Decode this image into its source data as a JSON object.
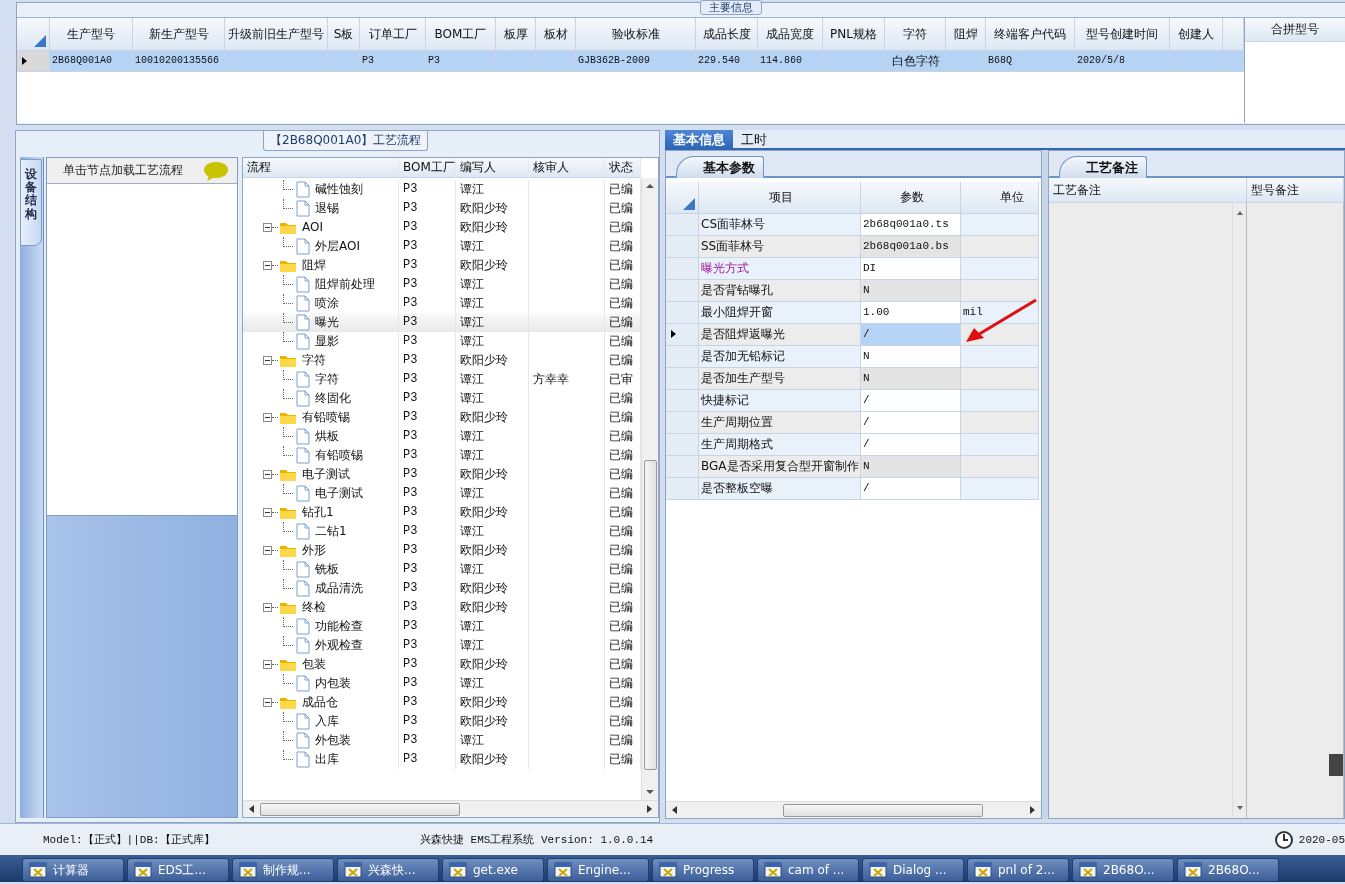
{
  "main_info": {
    "title": "主要信息",
    "columns": [
      "生产型号",
      "新生产型号",
      "升级前旧生产型号",
      "S板",
      "订单工厂",
      "BOM工厂",
      "板厚",
      "板材",
      "验收标准",
      "成品长度",
      "成品宽度",
      "PNL规格",
      "字符",
      "阻焊",
      "终端客户代码",
      "型号创建时间",
      "创建人"
    ],
    "rows": [
      {
        "selected": true,
        "cells": [
          "2B68Q001A0",
          "10010200135566",
          null,
          null,
          "P3",
          "P3",
          null,
          null,
          "GJB362B-2009",
          "229.540",
          "114.860",
          null,
          "白色字符",
          null,
          "B68Q",
          "2020/5/8",
          null
        ]
      }
    ],
    "side_column": "合拼型号"
  },
  "process": {
    "title": "【2B68Q001A0】工艺流程",
    "side_tab": "设备结构",
    "hint": "单击节点加载工艺流程",
    "columns": [
      "流程",
      "BOM工厂",
      "编写人",
      "核审人",
      "状态"
    ],
    "rows": [
      {
        "kind": "file",
        "name": "碱性蚀刻",
        "bom": "P3",
        "writer": "谭江",
        "status": "已编",
        "selected": false
      },
      {
        "kind": "file",
        "name": "退锡",
        "bom": "P3",
        "writer": "欧阳少玲",
        "status": "已编",
        "selected": false
      },
      {
        "kind": "folder",
        "name": "AOI",
        "bom": "P3",
        "writer": "欧阳少玲",
        "status": "已编",
        "selected": false,
        "expanded": true,
        "children": [
          {
            "kind": "file",
            "name": "外层AOI",
            "bom": "P3",
            "writer": "谭江",
            "status": "已编",
            "selected": false
          }
        ]
      },
      {
        "kind": "folder",
        "name": "阻焊",
        "bom": "P3",
        "writer": "欧阳少玲",
        "status": "已编",
        "selected": false,
        "expanded": true,
        "children": [
          {
            "kind": "file",
            "name": "阻焊前处理",
            "bom": "P3",
            "writer": "谭江",
            "status": "已编",
            "selected": false
          },
          {
            "kind": "file",
            "name": "喷涂",
            "bom": "P3",
            "writer": "谭江",
            "status": "已编",
            "selected": false
          },
          {
            "kind": "file",
            "name": "曝光",
            "bom": "P3",
            "writer": "谭江",
            "status": "已编",
            "selected": true
          },
          {
            "kind": "file",
            "name": "显影",
            "bom": "P3",
            "writer": "谭江",
            "status": "已编",
            "selected": false
          }
        ]
      },
      {
        "kind": "folder",
        "name": "字符",
        "bom": "P3",
        "writer": "欧阳少玲",
        "status": "已编",
        "selected": false,
        "expanded": true,
        "children": [
          {
            "kind": "file",
            "name": "字符",
            "bom": "P3",
            "writer": "谭江",
            "reviewer": "方幸幸",
            "status": "已审",
            "selected": false
          },
          {
            "kind": "file",
            "name": "终固化",
            "bom": "P3",
            "writer": "谭江",
            "status": "已编",
            "selected": false
          }
        ]
      },
      {
        "kind": "folder",
        "name": "有铅喷锡",
        "bom": "P3",
        "writer": "欧阳少玲",
        "status": "已编",
        "selected": false,
        "expanded": true,
        "children": [
          {
            "kind": "file",
            "name": "烘板",
            "bom": "P3",
            "writer": "谭江",
            "status": "已编",
            "selected": false
          },
          {
            "kind": "file",
            "name": "有铅喷锡",
            "bom": "P3",
            "writer": "谭江",
            "status": "已编",
            "selected": false
          }
        ]
      },
      {
        "kind": "folder",
        "name": "电子测试",
        "bom": "P3",
        "writer": "欧阳少玲",
        "status": "已编",
        "selected": false,
        "expanded": true,
        "children": [
          {
            "kind": "file",
            "name": "电子测试",
            "bom": "P3",
            "writer": "谭江",
            "status": "已编",
            "selected": false
          }
        ]
      },
      {
        "kind": "folder",
        "name": "钻孔1",
        "bom": "P3",
        "writer": "欧阳少玲",
        "status": "已编",
        "selected": false,
        "expanded": true,
        "children": [
          {
            "kind": "file",
            "name": "二钻1",
            "bom": "P3",
            "writer": "谭江",
            "status": "已编",
            "selected": false
          }
        ]
      },
      {
        "kind": "folder",
        "name": "外形",
        "bom": "P3",
        "writer": "欧阳少玲",
        "status": "已编",
        "selected": false,
        "expanded": true,
        "children": [
          {
            "kind": "file",
            "name": "铣板",
            "bom": "P3",
            "writer": "谭江",
            "status": "已编",
            "selected": false
          },
          {
            "kind": "file",
            "name": "成品清洗",
            "bom": "P3",
            "writer": "欧阳少玲",
            "status": "已编",
            "selected": false
          }
        ]
      },
      {
        "kind": "folder",
        "name": "终检",
        "bom": "P3",
        "writer": "欧阳少玲",
        "status": "已编",
        "selected": false,
        "expanded": true,
        "children": [
          {
            "kind": "file",
            "name": "功能检查",
            "bom": "P3",
            "writer": "谭江",
            "status": "已编",
            "selected": false
          },
          {
            "kind": "file",
            "name": "外观检查",
            "bom": "P3",
            "writer": "谭江",
            "status": "已编",
            "selected": false
          }
        ]
      },
      {
        "kind": "folder",
        "name": "包装",
        "bom": "P3",
        "writer": "欧阳少玲",
        "status": "已编",
        "selected": false,
        "expanded": true,
        "children": [
          {
            "kind": "file",
            "name": "内包装",
            "bom": "P3",
            "writer": "谭江",
            "status": "已编",
            "selected": false
          }
        ]
      },
      {
        "kind": "folder",
        "name": "成品仓",
        "bom": "P3",
        "writer": "欧阳少玲",
        "status": "已编",
        "selected": false,
        "expanded": true,
        "children": [
          {
            "kind": "file",
            "name": "入库",
            "bom": "P3",
            "writer": "欧阳少玲",
            "status": "已编",
            "selected": false
          },
          {
            "kind": "file",
            "name": "外包装",
            "bom": "P3",
            "writer": "谭江",
            "status": "已编",
            "selected": false
          },
          {
            "kind": "file",
            "name": "出库",
            "bom": "P3",
            "writer": "欧阳少玲",
            "status": "已编",
            "selected": false
          }
        ]
      }
    ]
  },
  "detail": {
    "tabs": [
      {
        "label": "基本信息",
        "selected": true
      },
      {
        "label": "工时",
        "selected": false
      }
    ],
    "params": {
      "title": "基本参数",
      "columns": [
        "项目",
        "参数",
        "单位"
      ],
      "rows": [
        {
          "item": "CS面菲林号",
          "value": "2b68q001a0.ts",
          "editable": true,
          "emphasized": false,
          "selected": false
        },
        {
          "item": "SS面菲林号",
          "value": "2b68q001a0.bs",
          "editable": false,
          "emphasized": false,
          "selected": false
        },
        {
          "item": "曝光方式",
          "value": "DI",
          "editable": true,
          "emphasized": true,
          "selected": false
        },
        {
          "item": "是否背钻曝孔",
          "value": "N",
          "editable": false,
          "emphasized": false,
          "selected": false
        },
        {
          "item": "最小阻焊开窗",
          "value": "1.00",
          "unit": "mil",
          "editable": true,
          "emphasized": false,
          "selected": false
        },
        {
          "item": "是否阻焊返曝光",
          "value": "/",
          "emphasized": false,
          "selected": true
        },
        {
          "item": "是否加无铅标记",
          "value": "N",
          "editable": true,
          "emphasized": false,
          "selected": false
        },
        {
          "item": "是否加生产型号",
          "value": "N",
          "editable": false,
          "emphasized": false,
          "selected": false
        },
        {
          "item": "快捷标记",
          "value": "/",
          "editable": true,
          "emphasized": false,
          "selected": false
        },
        {
          "item": "生产周期位置",
          "value": "/",
          "editable": true,
          "emphasized": false,
          "selected": false
        },
        {
          "item": "生产周期格式",
          "value": "/",
          "editable": true,
          "emphasized": false,
          "selected": false
        },
        {
          "item": "BGA是否采用复合型开窗制作",
          "value": "N",
          "editable": false,
          "emphasized": false,
          "selected": false
        },
        {
          "item": "是否整板空曝",
          "value": "/",
          "editable": true,
          "emphasized": false,
          "selected": false
        }
      ]
    },
    "notes": {
      "title": "工艺备注",
      "columns": [
        "工艺备注",
        "型号备注"
      ]
    }
  },
  "status_bar": {
    "left": "Model:【正式】||DB:【正式库】",
    "center": "兴森快捷 EMS工程系统 Version: 1.0.0.14",
    "date": "2020-05"
  },
  "taskbar": [
    "计算器",
    "EDS工...",
    "制作规...",
    "兴森快...",
    "get.exe",
    "Engine...",
    "Progress",
    "cam of ...",
    "Dialog ...",
    "pnl of 2...",
    "2B68O...",
    "2B68O..."
  ]
}
